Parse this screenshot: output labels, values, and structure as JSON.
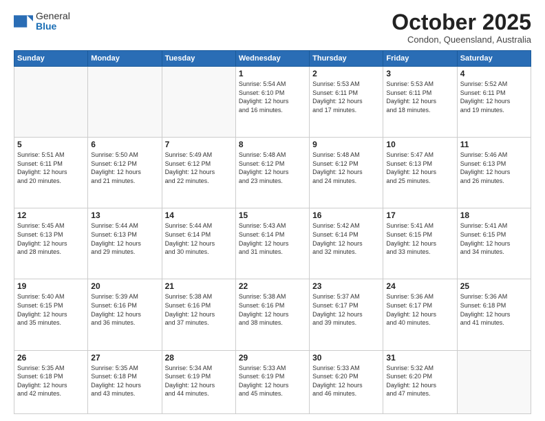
{
  "header": {
    "logo_general": "General",
    "logo_blue": "Blue",
    "title": "October 2025",
    "location": "Condon, Queensland, Australia"
  },
  "weekdays": [
    "Sunday",
    "Monday",
    "Tuesday",
    "Wednesday",
    "Thursday",
    "Friday",
    "Saturday"
  ],
  "weeks": [
    [
      {
        "day": "",
        "info": ""
      },
      {
        "day": "",
        "info": ""
      },
      {
        "day": "",
        "info": ""
      },
      {
        "day": "1",
        "info": "Sunrise: 5:54 AM\nSunset: 6:10 PM\nDaylight: 12 hours\nand 16 minutes."
      },
      {
        "day": "2",
        "info": "Sunrise: 5:53 AM\nSunset: 6:11 PM\nDaylight: 12 hours\nand 17 minutes."
      },
      {
        "day": "3",
        "info": "Sunrise: 5:53 AM\nSunset: 6:11 PM\nDaylight: 12 hours\nand 18 minutes."
      },
      {
        "day": "4",
        "info": "Sunrise: 5:52 AM\nSunset: 6:11 PM\nDaylight: 12 hours\nand 19 minutes."
      }
    ],
    [
      {
        "day": "5",
        "info": "Sunrise: 5:51 AM\nSunset: 6:11 PM\nDaylight: 12 hours\nand 20 minutes."
      },
      {
        "day": "6",
        "info": "Sunrise: 5:50 AM\nSunset: 6:12 PM\nDaylight: 12 hours\nand 21 minutes."
      },
      {
        "day": "7",
        "info": "Sunrise: 5:49 AM\nSunset: 6:12 PM\nDaylight: 12 hours\nand 22 minutes."
      },
      {
        "day": "8",
        "info": "Sunrise: 5:48 AM\nSunset: 6:12 PM\nDaylight: 12 hours\nand 23 minutes."
      },
      {
        "day": "9",
        "info": "Sunrise: 5:48 AM\nSunset: 6:12 PM\nDaylight: 12 hours\nand 24 minutes."
      },
      {
        "day": "10",
        "info": "Sunrise: 5:47 AM\nSunset: 6:13 PM\nDaylight: 12 hours\nand 25 minutes."
      },
      {
        "day": "11",
        "info": "Sunrise: 5:46 AM\nSunset: 6:13 PM\nDaylight: 12 hours\nand 26 minutes."
      }
    ],
    [
      {
        "day": "12",
        "info": "Sunrise: 5:45 AM\nSunset: 6:13 PM\nDaylight: 12 hours\nand 28 minutes."
      },
      {
        "day": "13",
        "info": "Sunrise: 5:44 AM\nSunset: 6:13 PM\nDaylight: 12 hours\nand 29 minutes."
      },
      {
        "day": "14",
        "info": "Sunrise: 5:44 AM\nSunset: 6:14 PM\nDaylight: 12 hours\nand 30 minutes."
      },
      {
        "day": "15",
        "info": "Sunrise: 5:43 AM\nSunset: 6:14 PM\nDaylight: 12 hours\nand 31 minutes."
      },
      {
        "day": "16",
        "info": "Sunrise: 5:42 AM\nSunset: 6:14 PM\nDaylight: 12 hours\nand 32 minutes."
      },
      {
        "day": "17",
        "info": "Sunrise: 5:41 AM\nSunset: 6:15 PM\nDaylight: 12 hours\nand 33 minutes."
      },
      {
        "day": "18",
        "info": "Sunrise: 5:41 AM\nSunset: 6:15 PM\nDaylight: 12 hours\nand 34 minutes."
      }
    ],
    [
      {
        "day": "19",
        "info": "Sunrise: 5:40 AM\nSunset: 6:15 PM\nDaylight: 12 hours\nand 35 minutes."
      },
      {
        "day": "20",
        "info": "Sunrise: 5:39 AM\nSunset: 6:16 PM\nDaylight: 12 hours\nand 36 minutes."
      },
      {
        "day": "21",
        "info": "Sunrise: 5:38 AM\nSunset: 6:16 PM\nDaylight: 12 hours\nand 37 minutes."
      },
      {
        "day": "22",
        "info": "Sunrise: 5:38 AM\nSunset: 6:16 PM\nDaylight: 12 hours\nand 38 minutes."
      },
      {
        "day": "23",
        "info": "Sunrise: 5:37 AM\nSunset: 6:17 PM\nDaylight: 12 hours\nand 39 minutes."
      },
      {
        "day": "24",
        "info": "Sunrise: 5:36 AM\nSunset: 6:17 PM\nDaylight: 12 hours\nand 40 minutes."
      },
      {
        "day": "25",
        "info": "Sunrise: 5:36 AM\nSunset: 6:18 PM\nDaylight: 12 hours\nand 41 minutes."
      }
    ],
    [
      {
        "day": "26",
        "info": "Sunrise: 5:35 AM\nSunset: 6:18 PM\nDaylight: 12 hours\nand 42 minutes."
      },
      {
        "day": "27",
        "info": "Sunrise: 5:35 AM\nSunset: 6:18 PM\nDaylight: 12 hours\nand 43 minutes."
      },
      {
        "day": "28",
        "info": "Sunrise: 5:34 AM\nSunset: 6:19 PM\nDaylight: 12 hours\nand 44 minutes."
      },
      {
        "day": "29",
        "info": "Sunrise: 5:33 AM\nSunset: 6:19 PM\nDaylight: 12 hours\nand 45 minutes."
      },
      {
        "day": "30",
        "info": "Sunrise: 5:33 AM\nSunset: 6:20 PM\nDaylight: 12 hours\nand 46 minutes."
      },
      {
        "day": "31",
        "info": "Sunrise: 5:32 AM\nSunset: 6:20 PM\nDaylight: 12 hours\nand 47 minutes."
      },
      {
        "day": "",
        "info": ""
      }
    ]
  ]
}
